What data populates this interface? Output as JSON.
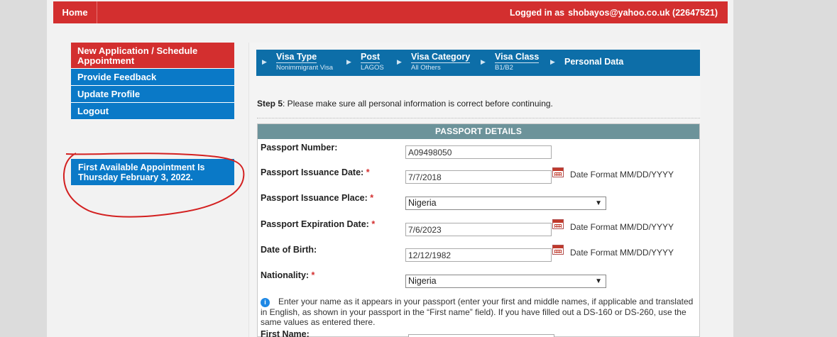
{
  "topbar": {
    "home_label": "Home",
    "logged_prefix": "Logged in as",
    "user": "shobayos@yahoo.co.uk (22647521)"
  },
  "sidebar": {
    "items": [
      {
        "label": "New Application / Schedule Appointment"
      },
      {
        "label": "Provide Feedback"
      },
      {
        "label": "Update Profile"
      },
      {
        "label": "Logout"
      }
    ],
    "appointment_text": "First Available Appointment Is Thursday February 3, 2022."
  },
  "breadcrumb": {
    "steps": [
      {
        "title": "Visa Type",
        "value": "Nonimmigrant Visa"
      },
      {
        "title": "Post",
        "value": "LAGOS"
      },
      {
        "title": "Visa Category",
        "value": "All Others"
      },
      {
        "title": "Visa Class",
        "value": "B1/B2"
      },
      {
        "title": "Personal Data",
        "value": ""
      }
    ]
  },
  "step": {
    "label": "Step 5",
    "text": ": Please make sure all personal information is correct before continuing."
  },
  "passport": {
    "header": "PASSPORT DETAILS",
    "number_label": "Passport Number:",
    "number_value": "A09498050",
    "issuance_date_label": "Passport Issuance Date:",
    "issuance_date_value": "7/7/2018",
    "issuance_place_label": "Passport Issuance Place:",
    "issuance_place_value": "Nigeria",
    "expiration_label": "Passport Expiration Date:",
    "expiration_value": "7/6/2023",
    "dob_label": "Date of Birth:",
    "dob_value": "12/12/1982",
    "nationality_label": "Nationality:",
    "nationality_value": "Nigeria",
    "date_format": "Date Format MM/DD/YYYY",
    "required_mark": "*",
    "info_text": "Enter your name as it appears in your passport (enter your first and middle names, if applicable and translated in English, as shown in your passport in the “First name” field). If you have filled out a DS-160 or DS-260, use the same values as entered there.",
    "first_name_label": "First Name:"
  },
  "colors": {
    "topbar": "#d32f2f",
    "nav_blue": "#0a79c7",
    "breadcrumb": "#0d6ea8",
    "panel_header": "#6c939a"
  }
}
